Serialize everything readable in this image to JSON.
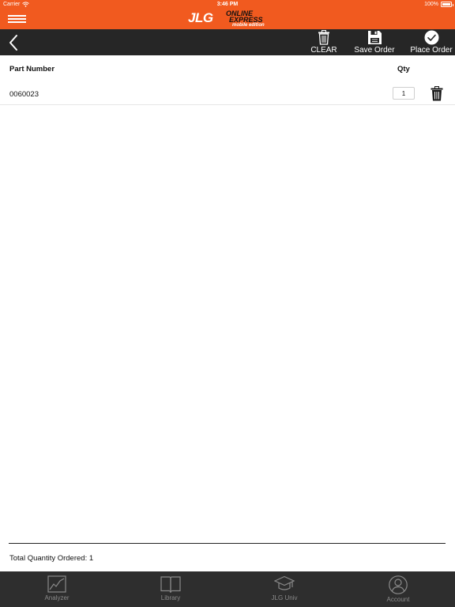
{
  "status_bar": {
    "carrier": "Carrier",
    "time": "3:46 PM",
    "battery": "100%"
  },
  "header": {
    "logo_brand": "JLG",
    "logo_line1": "ONLINE",
    "logo_line2": "EXPRESS",
    "logo_line3": "mobile edition",
    "brand_color": "#f15a1f"
  },
  "toolbar": {
    "clear_label": "CLEAR",
    "save_label": "Save Order",
    "place_label": "Place Order"
  },
  "table": {
    "col_part": "Part Number",
    "col_qty": "Qty",
    "rows": [
      {
        "part_number": "0060023",
        "qty": "1"
      }
    ]
  },
  "summary": {
    "total_text": "Total Quantity Ordered: 1"
  },
  "tabs": [
    {
      "label": "Analyzer",
      "icon": "chart-icon"
    },
    {
      "label": "Library",
      "icon": "book-icon"
    },
    {
      "label": "JLG Univ",
      "icon": "graduation-cap-icon"
    },
    {
      "label": "Account",
      "icon": "user-icon"
    }
  ]
}
